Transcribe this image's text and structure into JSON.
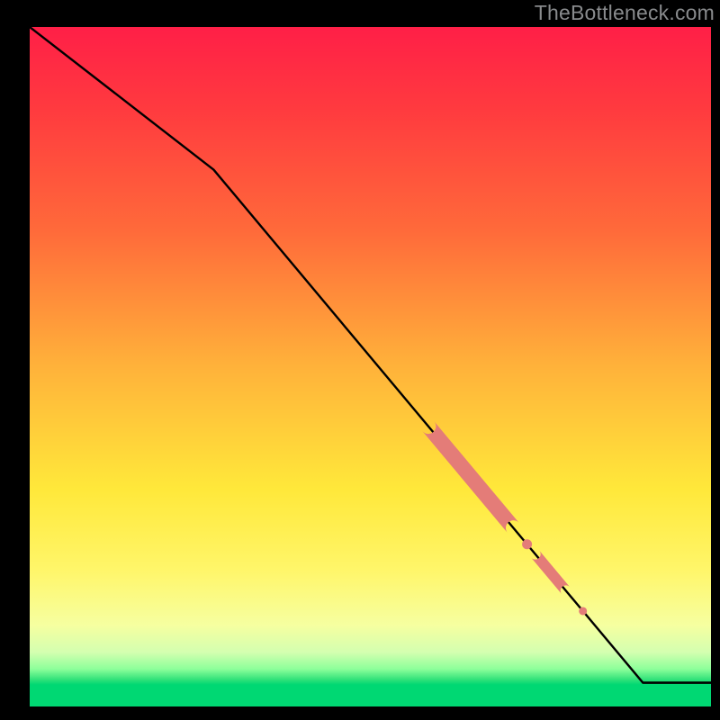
{
  "watermark": "TheBottleneck.com",
  "colors": {
    "curve": "#000000",
    "blob": "#e47c78",
    "bg": "#000000"
  },
  "chart_data": {
    "type": "line",
    "title": "",
    "xlabel": "",
    "ylabel": "",
    "xlim": [
      0,
      100
    ],
    "ylim": [
      0,
      100
    ],
    "grid": false,
    "series": [
      {
        "name": "bottleneck-curve",
        "x": [
          0,
          27,
          90,
          100
        ],
        "y": [
          100,
          79,
          3.5,
          3.5
        ]
      }
    ],
    "annotations": [
      {
        "name": "highlight-segment-1",
        "x_start": 58.5,
        "x_end": 71,
        "on_series": "bottleneck-curve",
        "style": "thick"
      },
      {
        "name": "highlight-dot-1",
        "x": 73.0,
        "on_series": "bottleneck-curve",
        "style": "dot"
      },
      {
        "name": "highlight-segment-2",
        "x_start": 74.2,
        "x_end": 78.7,
        "on_series": "bottleneck-curve",
        "style": "medium"
      },
      {
        "name": "highlight-dot-2",
        "x": 81.2,
        "on_series": "bottleneck-curve",
        "style": "dot"
      }
    ]
  }
}
